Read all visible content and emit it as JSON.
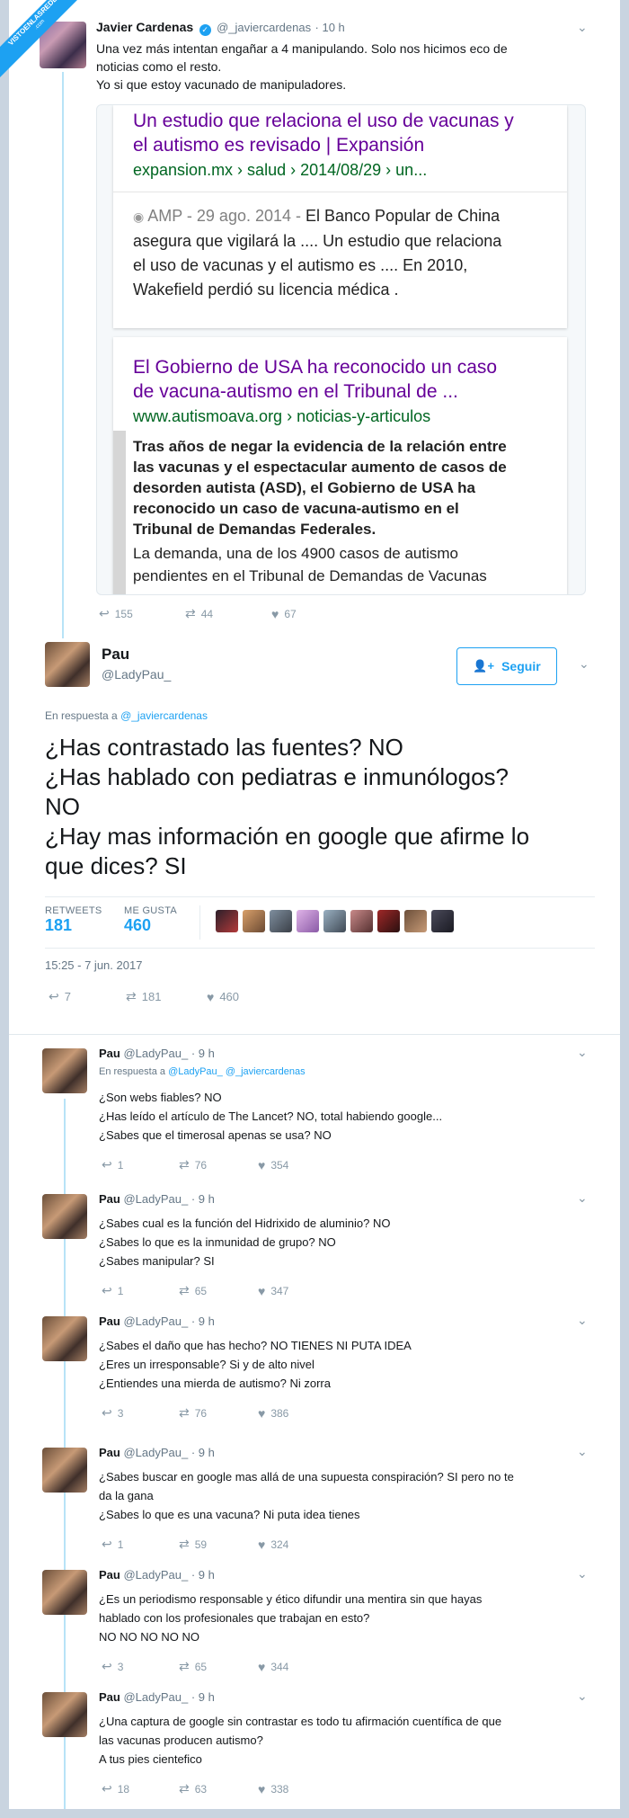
{
  "watermark": {
    "line1": "VISTOENLASREDES",
    "line2": ".com"
  },
  "tweet1": {
    "name": "Javier Cardenas",
    "handle": "@_javiercardenas",
    "time": "· 10 h",
    "lines": [
      "Una vez más intentan engañar a 4 manipulando. Solo nos hicimos eco de",
      "noticias como el resto.",
      "Yo si que estoy vacunado de manipuladores."
    ],
    "card1": {
      "title_l1": "Un estudio que relaciona el uso de vacunas y",
      "title_l2": "el autismo es revisado | Expansión",
      "url": "expansion.mx › salud › 2014/08/29 › un...",
      "amp_date": "AMP - 29 ago. 2014 -",
      "snip_l1": " El Banco Popular de China",
      "snip_l2": "asegura que vigilará la .... Un estudio que relaciona",
      "snip_l3": "el uso de vacunas y el autismo es .... En 2010,",
      "snip_l4": "Wakefield perdió su licencia médica ."
    },
    "card2": {
      "title_l1": "El Gobierno de USA ha reconocido un caso",
      "title_l2": "de vacuna-autismo en el Tribunal de ...",
      "url": "www.autismoava.org › noticias-y-articulos",
      "bold_l1": "Tras años de negar la evidencia de la relación entre",
      "bold_l2": "las vacunas y el espectacular aumento de casos de",
      "bold_l3": "desorden autista (ASD), el Gobierno de USA ha",
      "bold_l4": "reconocido un caso de vacuna-autismo en el",
      "bold_l5": "Tribunal de Demandas Federales.",
      "snip_l1": "La demanda, una de los 4900 casos de autismo",
      "snip_l2": "pendientes en el Tribunal de Demandas de Vacunas"
    },
    "replies": "155",
    "retweets": "44",
    "likes": "67"
  },
  "main": {
    "name": "Pau",
    "handle": "@LadyPau_",
    "follow_label": "Seguir",
    "reply_to_prefix": "En respuesta a",
    "reply_to": "@_javiercardenas",
    "lines": [
      "¿Has contrastado las fuentes? NO",
      "¿Has hablado con pediatras e inmunólogos?",
      "NO",
      "¿Hay mas información en google que afirme lo",
      "que dices? SI"
    ],
    "retweets_label": "RETWEETS",
    "retweets": "181",
    "likes_label": "ME GUSTA",
    "likes": "460",
    "timestamp": "15:25 - 7 jun. 2017",
    "action_replies": "7",
    "action_retweets": "181",
    "action_likes": "460"
  },
  "replies": [
    {
      "name": "Pau",
      "handle": "@LadyPau_",
      "time": "· 9 h",
      "reply_prefix": "En respuesta a",
      "reply_to": "@LadyPau_ @_javiercardenas",
      "lines": [
        "¿Son webs fiables? NO",
        "¿Has leído el artículo de The Lancet? NO, total habiendo google...",
        "¿Sabes que el timerosal apenas se usa? NO"
      ],
      "r": "1",
      "rt": "76",
      "l": "354"
    },
    {
      "name": "Pau",
      "handle": "@LadyPau_",
      "time": "· 9 h",
      "lines": [
        "¿Sabes cual es la función del Hidrixido de aluminio? NO",
        "¿Sabes lo que es la inmunidad de grupo? NO",
        "¿Sabes manipular? SI"
      ],
      "r": "1",
      "rt": "65",
      "l": "347"
    },
    {
      "name": "Pau",
      "handle": "@LadyPau_",
      "time": "· 9 h",
      "lines": [
        "¿Sabes el daño que has hecho? NO TIENES NI PUTA IDEA",
        "¿Eres un irresponsable? Si y de alto nivel",
        "¿Entiendes una mierda de autismo? Ni zorra"
      ],
      "r": "3",
      "rt": "76",
      "l": "386"
    },
    {
      "name": "Pau",
      "handle": "@LadyPau_",
      "time": "· 9 h",
      "lines": [
        "¿Sabes buscar en google mas allá de una supuesta conspiración? SI pero no te",
        "da la gana",
        "¿Sabes lo que es una vacuna? Ni puta idea tienes"
      ],
      "r": "1",
      "rt": "59",
      "l": "324"
    },
    {
      "name": "Pau",
      "handle": "@LadyPau_",
      "time": "· 9 h",
      "lines": [
        "¿Es un periodismo responsable y ético difundir una mentira sin que hayas",
        "hablado con los profesionales que trabajan en esto?",
        "NO NO NO NO NO"
      ],
      "r": "3",
      "rt": "65",
      "l": "344"
    },
    {
      "name": "Pau",
      "handle": "@LadyPau_",
      "time": "· 9 h",
      "lines": [
        "¿Una captura de google sin contrastar es todo tu afirmación cuentífica de que",
        "las vacunas producen autismo?",
        "A tus pies cientefico"
      ],
      "r": "18",
      "rt": "63",
      "l": "338"
    }
  ],
  "icons": {
    "reply": "reply-icon",
    "retweet": "retweet-icon",
    "like": "heart-icon",
    "more": "chevron-down-icon"
  },
  "colors": {
    "twitter_blue": "#1da1f2",
    "google_title": "#660099",
    "google_url": "#006621"
  }
}
